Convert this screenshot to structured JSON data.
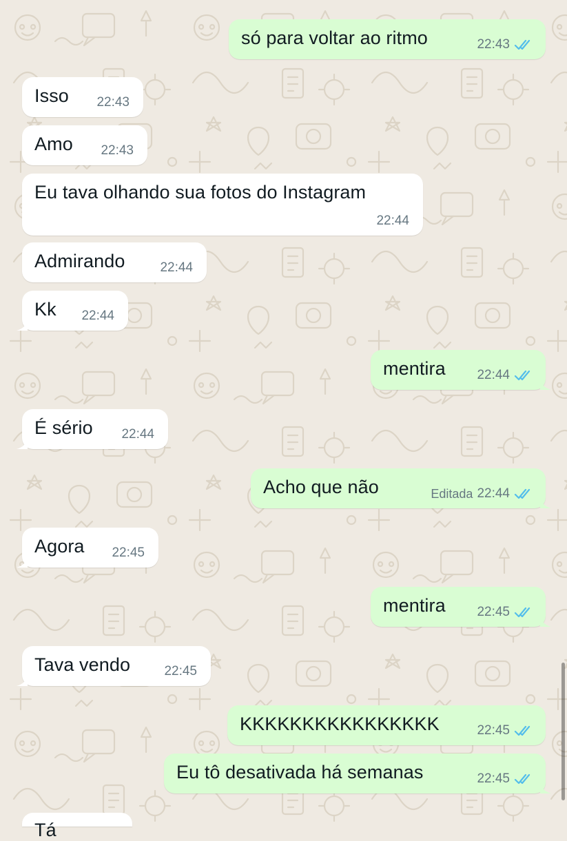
{
  "theme": {
    "background": "#efeae2",
    "incoming_bubble": "#ffffff",
    "outgoing_bubble": "#d9fdd3",
    "read_tick": "#53bdeb",
    "time_color": "#667781"
  },
  "messages": [
    {
      "dir": "out",
      "text": "só para voltar ao ritmo",
      "time": "22:43",
      "ticks": "double-check-read-icon"
    },
    {
      "dir": "in",
      "text": "Isso",
      "time": "22:43"
    },
    {
      "dir": "in",
      "text": "Amo",
      "time": "22:43"
    },
    {
      "dir": "in",
      "text": "Eu tava olhando sua fotos do Instagram",
      "time": "22:44"
    },
    {
      "dir": "in",
      "text": "Admirando",
      "time": "22:44"
    },
    {
      "dir": "in",
      "text": "Kk",
      "time": "22:44"
    },
    {
      "dir": "out",
      "text": "mentira",
      "time": "22:44",
      "ticks": "double-check-read-icon"
    },
    {
      "dir": "in",
      "text": "É sério",
      "time": "22:44"
    },
    {
      "dir": "out",
      "text": "Acho que não",
      "edited": "Editada",
      "time": "22:44",
      "ticks": "double-check-read-icon"
    },
    {
      "dir": "in",
      "text": "Agora",
      "time": "22:45"
    },
    {
      "dir": "out",
      "text": "mentira",
      "time": "22:45",
      "ticks": "double-check-read-icon"
    },
    {
      "dir": "in",
      "text": "Tava vendo",
      "time": "22:45"
    },
    {
      "dir": "out",
      "text": "KKKKKKKKKKKKKKKK",
      "time": "22:45",
      "ticks": "double-check-read-icon"
    },
    {
      "dir": "out",
      "text": "Eu tô desativada há semanas",
      "time": "22:45",
      "ticks": "double-check-read-icon"
    },
    {
      "dir": "in",
      "text": "Tá ",
      "time": ""
    }
  ]
}
